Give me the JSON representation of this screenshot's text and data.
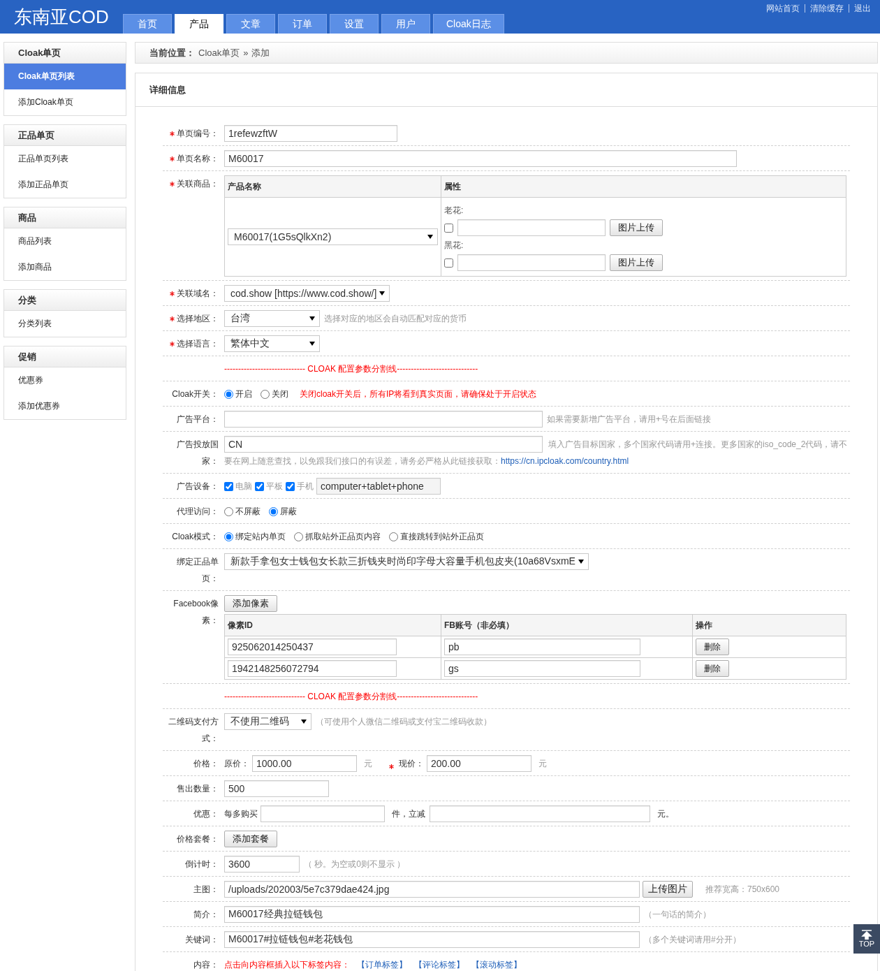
{
  "header": {
    "logo": "东南亚COD",
    "nav": [
      {
        "label": "首页",
        "selected": false
      },
      {
        "label": "产品",
        "selected": true
      },
      {
        "label": "文章",
        "selected": false
      },
      {
        "label": "订单",
        "selected": false
      },
      {
        "label": "设置",
        "selected": false
      },
      {
        "label": "用户",
        "selected": false
      },
      {
        "label": "Cloak日志",
        "selected": false
      }
    ],
    "links": [
      "网站首页",
      "清除缓存",
      "退出"
    ]
  },
  "sidebar": [
    {
      "title": "Cloak单页",
      "items": [
        {
          "label": "Cloak单页列表",
          "selected": true
        },
        {
          "label": "添加Cloak单页",
          "selected": false
        }
      ]
    },
    {
      "title": "正品单页",
      "items": [
        {
          "label": "正品单页列表",
          "selected": false
        },
        {
          "label": "添加正品单页",
          "selected": false
        }
      ]
    },
    {
      "title": "商品",
      "items": [
        {
          "label": "商品列表",
          "selected": false
        },
        {
          "label": "添加商品",
          "selected": false
        }
      ]
    },
    {
      "title": "分类",
      "items": [
        {
          "label": "分类列表",
          "selected": false
        }
      ]
    },
    {
      "title": "促销",
      "items": [
        {
          "label": "优惠券",
          "selected": false
        },
        {
          "label": "添加优惠券",
          "selected": false
        }
      ]
    }
  ],
  "breadcrumb": {
    "label": "当前位置：",
    "items": [
      "Cloak单页",
      "添加"
    ],
    "separator": "»"
  },
  "panel_title": "详细信息",
  "form": [
    {
      "kind": "input",
      "label": "单页编号：",
      "required": true,
      "value": "1refewzftW"
    },
    {
      "kind": "input",
      "label": "单页名称：",
      "required": true,
      "value": "M60017"
    },
    {
      "kind": "product-table",
      "label": "关联商品：",
      "required": true,
      "columns": [
        "产品名称",
        "属性"
      ],
      "product": "M60017(1G5sQlkXn2)",
      "attributes": [
        {
          "name": "老花:",
          "checked": false,
          "button": "图片上传"
        },
        {
          "name": "黑花:",
          "checked": false,
          "button": "图片上传"
        }
      ]
    },
    {
      "kind": "select",
      "label": "关联域名：",
      "required": true,
      "value": "cod.show [https://www.cod.show/]"
    },
    {
      "kind": "select",
      "label": "选择地区：",
      "required": true,
      "value": "台湾",
      "hint": "选择对应的地区会自动匹配对应的货币"
    },
    {
      "kind": "select",
      "label": "选择语言：",
      "required": true,
      "value": "繁体中文"
    },
    {
      "kind": "divider",
      "text": "----------------------------- CLOAK 配置参数分割线-----------------------------"
    },
    {
      "kind": "radio",
      "label": "Cloak开关：",
      "options": [
        {
          "label": "开启",
          "selected": true
        },
        {
          "label": "关闭",
          "selected": false
        }
      ],
      "warning": "关闭cloak开关后，所有IP将看到真实页面，请确保处于开启状态"
    },
    {
      "kind": "input",
      "label": "广告平台：",
      "hint": "如果需要新增广告平台，请用+号在后面链接"
    },
    {
      "kind": "ad-country",
      "label": "广告投放国家：",
      "value": "CN",
      "hint": "填入广告目标国家，多个国家代码请用+连接。更多国家的iso_code_2代码，请不",
      "hint_2": "要在网上随意查找，以免跟我们接口的有误差，请务必严格从此链接获取：",
      "link": "https://cn.ipcloak.com/country.html"
    },
    {
      "kind": "checkboxes",
      "label": "广告设备：",
      "options": [
        {
          "label": "电脑",
          "checked": true
        },
        {
          "label": "平板",
          "checked": true
        },
        {
          "label": "手机",
          "checked": true
        }
      ],
      "value": "computer+tablet+phone"
    },
    {
      "kind": "radio",
      "label": "代理访问：",
      "options": [
        {
          "label": "不屏蔽",
          "selected": false
        },
        {
          "label": "屏蔽",
          "selected": true
        }
      ]
    },
    {
      "kind": "radio",
      "label": "Cloak模式：",
      "options": [
        {
          "label": "绑定站内单页",
          "selected": true
        },
        {
          "label": "抓取站外正品页内容",
          "selected": false
        },
        {
          "label": "直接跳转到站外正品页",
          "selected": false
        }
      ]
    },
    {
      "kind": "select",
      "label": "绑定正品单页：",
      "value": "新款手拿包女士钱包女长款三折钱夹时尚印字母大容量手机包皮夹(10a68VsxmE"
    },
    {
      "kind": "pixel-table",
      "label": "Facebook像素：",
      "button": "添加像素",
      "columns": [
        "像素ID",
        "FB账号（非必填）",
        "操作"
      ],
      "rows": [
        {
          "id": "925062014250437",
          "account": "pb",
          "action": "删除"
        },
        {
          "id": "1942148256072794",
          "account": "gs",
          "action": "删除"
        }
      ]
    },
    {
      "kind": "divider",
      "text": "----------------------------- CLOAK 配置参数分割线-----------------------------"
    },
    {
      "kind": "select",
      "label": "二维码支付方式：",
      "value": "不使用二维码",
      "hint": "（可使用个人微信二维码或支付宝二维码收款）"
    },
    {
      "kind": "price",
      "label": "价格：",
      "original_label": "原价：",
      "original": "1000.00",
      "original_unit": "元",
      "current_required": true,
      "current_label": "现价：",
      "current": "200.00",
      "current_unit": "元"
    },
    {
      "kind": "input",
      "label": "售出数量：",
      "value": "500"
    },
    {
      "kind": "discount",
      "label": "优惠：",
      "prefix": "每多购买",
      "middle": "件，立减",
      "suffix": "元。"
    },
    {
      "kind": "button",
      "label": "价格套餐：",
      "button": "添加套餐"
    },
    {
      "kind": "input",
      "label": "倒计时：",
      "value": "3600",
      "hint": "（ 秒。为空或0则不显示 ）"
    },
    {
      "kind": "upload",
      "label": "主图：",
      "value": "/uploads/202003/5e7c379dae424.jpg",
      "button": "上传图片",
      "hint": "推荐宽高：750x600"
    },
    {
      "kind": "input",
      "label": "简介：",
      "value": "M60017经典拉链钱包",
      "hint": "（一句话的简介）"
    },
    {
      "kind": "input",
      "label": "关键词：",
      "value": "M60017#拉链钱包#老花钱包",
      "hint": "（多个关键词请用#分开）"
    },
    {
      "kind": "tags",
      "label": "内容：",
      "text": "点击向内容框插入以下标签内容：",
      "links": [
        "【订单标签】",
        "【评论标签】",
        "【滚动标签】"
      ]
    }
  ],
  "top_button": "TOP"
}
